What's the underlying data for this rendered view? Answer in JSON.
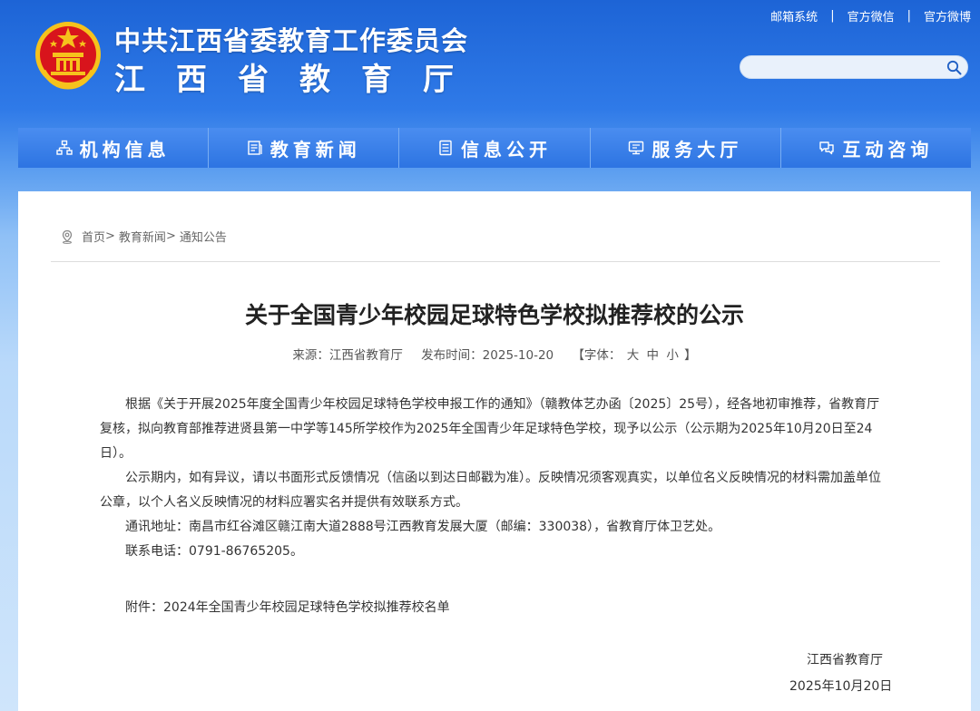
{
  "header": {
    "org_name": "中共江西省委教育工作委员会",
    "dept_name": "江西省教育厅",
    "links": [
      "邮箱系统",
      "官方微信",
      "官方微博"
    ],
    "search_placeholder": ""
  },
  "nav": [
    {
      "label": "机构信息",
      "icon": "org-chart-icon"
    },
    {
      "label": "教育新闻",
      "icon": "news-icon"
    },
    {
      "label": "信息公开",
      "icon": "document-icon"
    },
    {
      "label": "服务大厅",
      "icon": "monitor-icon"
    },
    {
      "label": "互动咨询",
      "icon": "chat-icon"
    }
  ],
  "breadcrumb": {
    "home": "首页",
    "sep": ">",
    "level1": "教育新闻",
    "level2": "通知公告"
  },
  "article": {
    "title": "关于全国青少年校园足球特色学校拟推荐校的公示",
    "source": "来源：江西省教育厅",
    "date": "发布时间：2025-10-20",
    "font_prefix": "【字体：",
    "font_large": "大",
    "font_medium": "中",
    "font_small": "小",
    "font_suffix": "】",
    "paragraphs": [
      "根据《关于开展2025年度全国青少年校园足球特色学校申报工作的通知》（赣教体艺办函〔2025〕25号），经各地初审推荐，省教育厅复核，拟向教育部推荐进贤县第一中学等145所学校作为2025年全国青少年足球特色学校，现予以公示（公示期为2025年10月20日至24日）。",
      "公示期内，如有异议，请以书面形式反馈情况（信函以到达日邮戳为准）。反映情况须客观真实，以单位名义反映情况的材料需加盖单位公章，以个人名义反映情况的材料应署实名并提供有效联系方式。",
      "通讯地址：南昌市红谷滩区赣江南大道2888号江西教育发展大厦（邮编：330038），省教育厅体卫艺处。",
      "联系电话：0791-86765205。"
    ],
    "attachment_prefix": "附件：",
    "attachment": "2024年全国青少年校园足球特色学校拟推荐校名单",
    "signature_org": "江西省教育厅",
    "signature_date": "2025年10月20日"
  },
  "colors": {
    "primary_blue": "#1d64d6",
    "nav_blue": "#2d74e2",
    "emblem_red": "#d8141c",
    "emblem_gold": "#f6c21c"
  }
}
